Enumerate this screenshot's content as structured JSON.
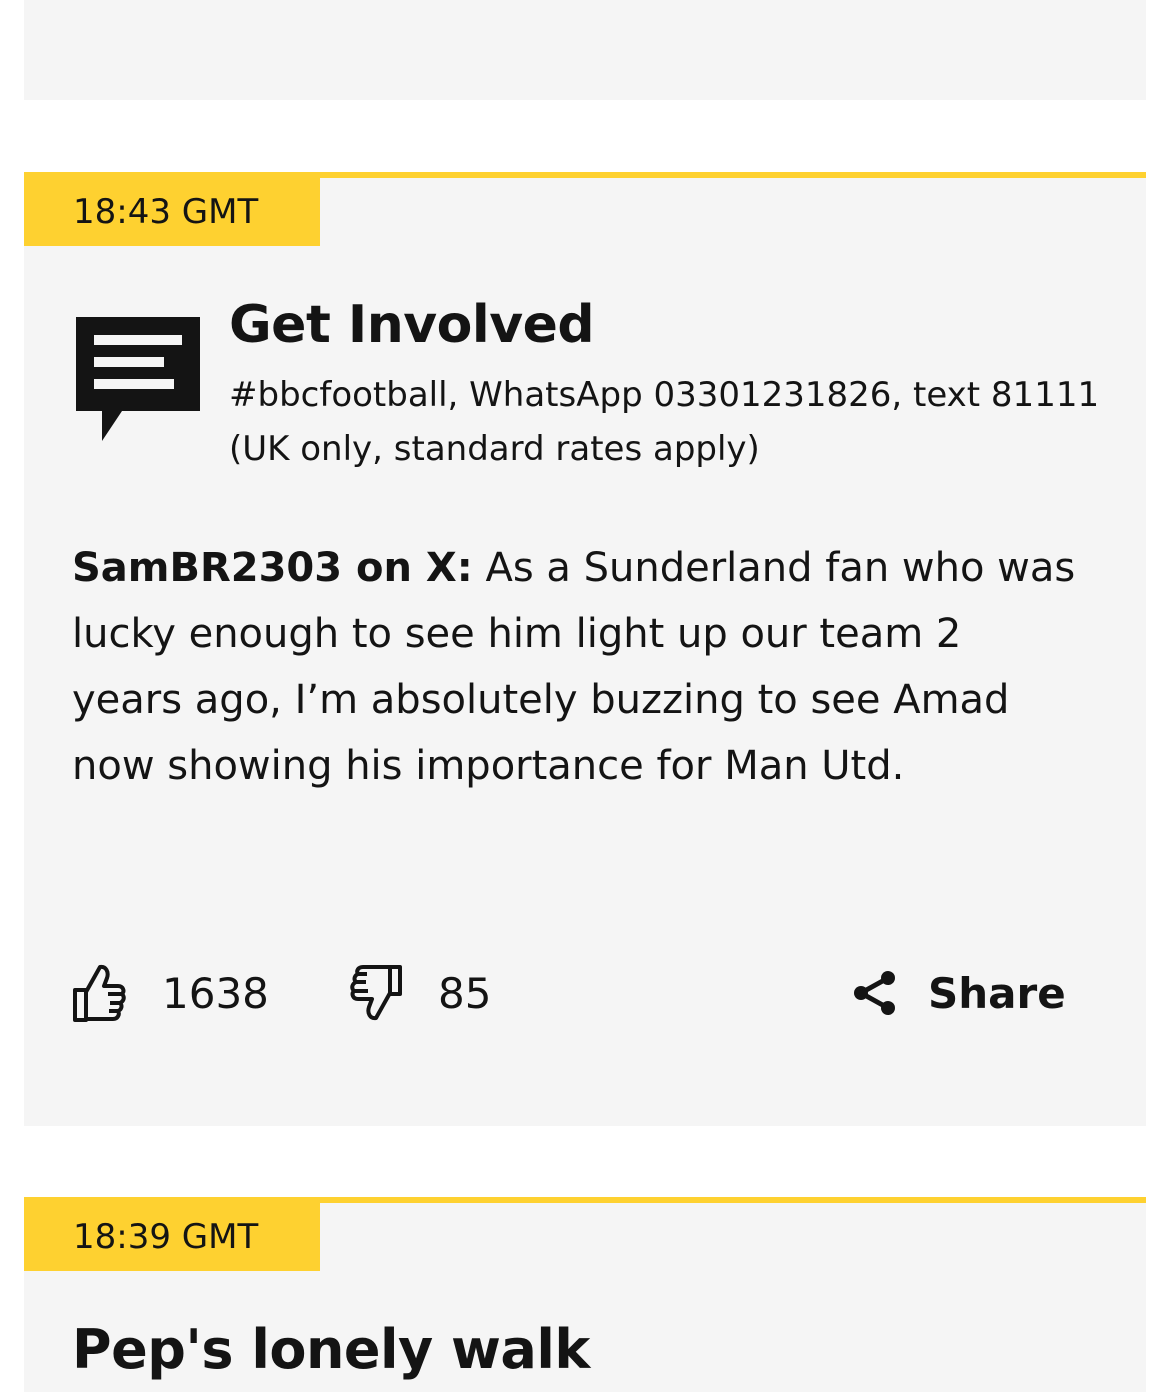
{
  "posts": [
    {
      "time": "18:43 GMT",
      "get_involved": {
        "title": "Get Involved",
        "subtitle": "#bbcfootball, WhatsApp 03301231826, text 81111 (UK only, standard rates apply)"
      },
      "author": "SamBR2303 on X:",
      "body": " As a Sunderland fan who was lucky enough to see him light up our team 2 years ago, I’m absolutely buzzing to see Amad now showing his importance for Man Utd.",
      "likes": "1638",
      "dislikes": "85",
      "share_label": "Share"
    },
    {
      "time": "18:39 GMT",
      "title": "Pep's lonely walk"
    }
  ],
  "colors": {
    "accent_yellow": "#fed130",
    "card_background": "#f5f5f5",
    "text": "#141414"
  },
  "icons": {
    "get_involved": "speech-bubble-icon",
    "like": "thumbs-up-icon",
    "dislike": "thumbs-down-icon",
    "share": "share-icon"
  }
}
